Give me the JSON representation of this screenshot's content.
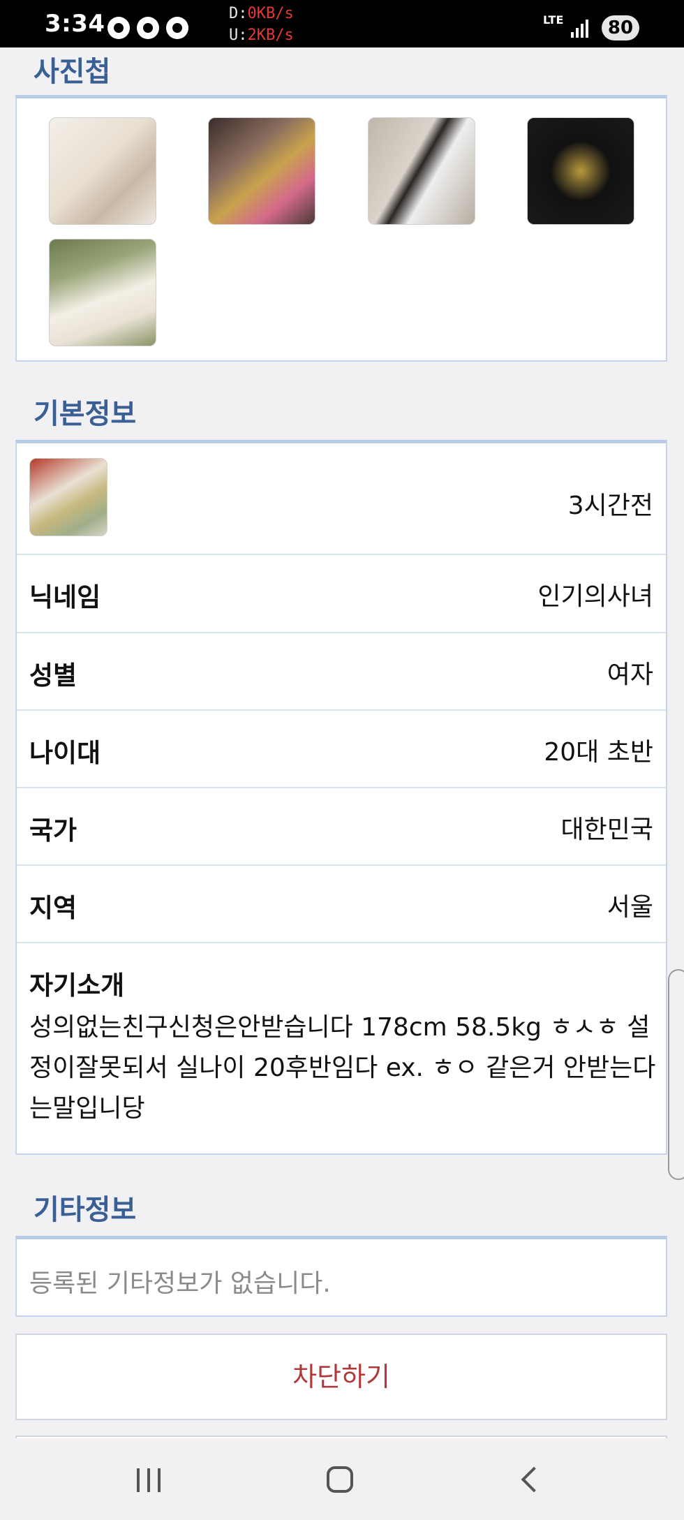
{
  "status_bar": {
    "time": "3:34",
    "net_down_label": "D:",
    "net_down_value": "0KB/s",
    "net_up_label": "U:",
    "net_up_value": "2KB/s",
    "network_type": "LTE",
    "battery": "80"
  },
  "album": {
    "title": "사진첩",
    "photos": [
      "photo-1",
      "photo-2",
      "photo-3",
      "photo-4",
      "photo-5"
    ]
  },
  "basic_info": {
    "title": "기본정보",
    "last_active": "3시간전",
    "rows": [
      {
        "label": "닉네임",
        "value": "인기의사녀"
      },
      {
        "label": "성별",
        "value": "여자"
      },
      {
        "label": "나이대",
        "value": "20대 초반"
      },
      {
        "label": "국가",
        "value": "대한민국"
      },
      {
        "label": "지역",
        "value": "서울"
      }
    ],
    "intro_label": "자기소개",
    "intro_text": "성의없는친구신청은안받습니다 178cm 58.5kg ㅎㅅㅎ 설정이잘못되서 실나이 20후반임다 ex. ㅎㅇ 같은거 안받는다는말입니당"
  },
  "other_info": {
    "title": "기타정보",
    "empty_text": "등록된 기타정보가 없습니다."
  },
  "actions": {
    "block_label": "차단하기"
  },
  "colors": {
    "section_title": "#3a5f95",
    "panel_border": "#b6cbe6",
    "block_text": "#b03a3a"
  }
}
